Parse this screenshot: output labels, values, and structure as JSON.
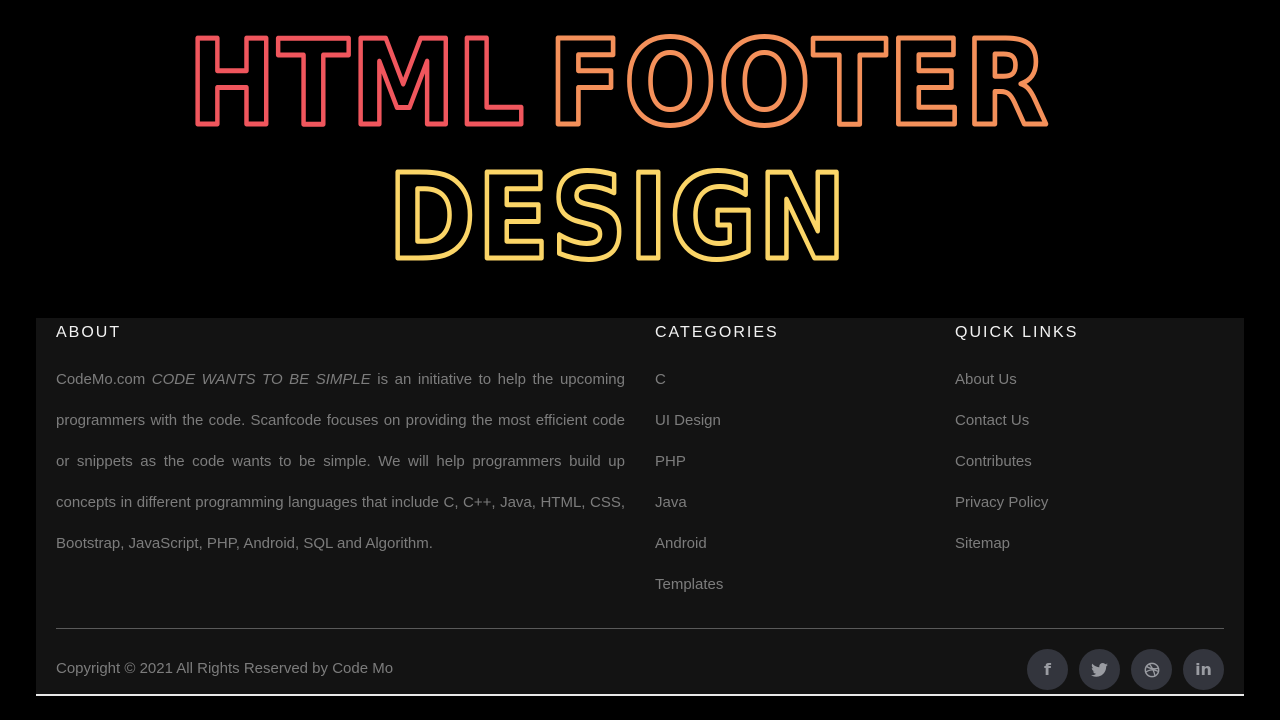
{
  "banner": {
    "line1_part1": "HTML",
    "line1_part2": "FOOTER",
    "line2": "DESIGN",
    "colors": {
      "html": "#f0565d",
      "footer": "#f4905a",
      "design": "#fbd567"
    }
  },
  "footer": {
    "about": {
      "heading": "ABOUT",
      "text_prefix": "CodeMo.com ",
      "text_emphasis": "CODE WANTS TO BE SIMPLE",
      "text_suffix": " is an initiative to help the upcoming programmers with the code. Scanfcode focuses on providing the most efficient code or snippets as the code wants to be simple. We will help programmers build up concepts in different programming languages that include C, C++, Java, HTML, CSS, Bootstrap, JavaScript, PHP, Android, SQL and Algorithm."
    },
    "categories": {
      "heading": "CATEGORIES",
      "items": [
        "C",
        "UI Design",
        "PHP",
        "Java",
        "Android",
        "Templates"
      ]
    },
    "quick_links": {
      "heading": "QUICK LINKS",
      "items": [
        "About Us",
        "Contact Us",
        "Contributes",
        "Privacy Policy",
        "Sitemap"
      ]
    },
    "copyright": "Copyright © 2021 All Rights Reserved by Code Mo",
    "social": [
      {
        "name": "facebook-icon",
        "label": "f"
      },
      {
        "name": "twitter-icon",
        "label": ""
      },
      {
        "name": "dribbble-icon",
        "label": ""
      },
      {
        "name": "linkedin-icon",
        "label": "in"
      }
    ]
  }
}
